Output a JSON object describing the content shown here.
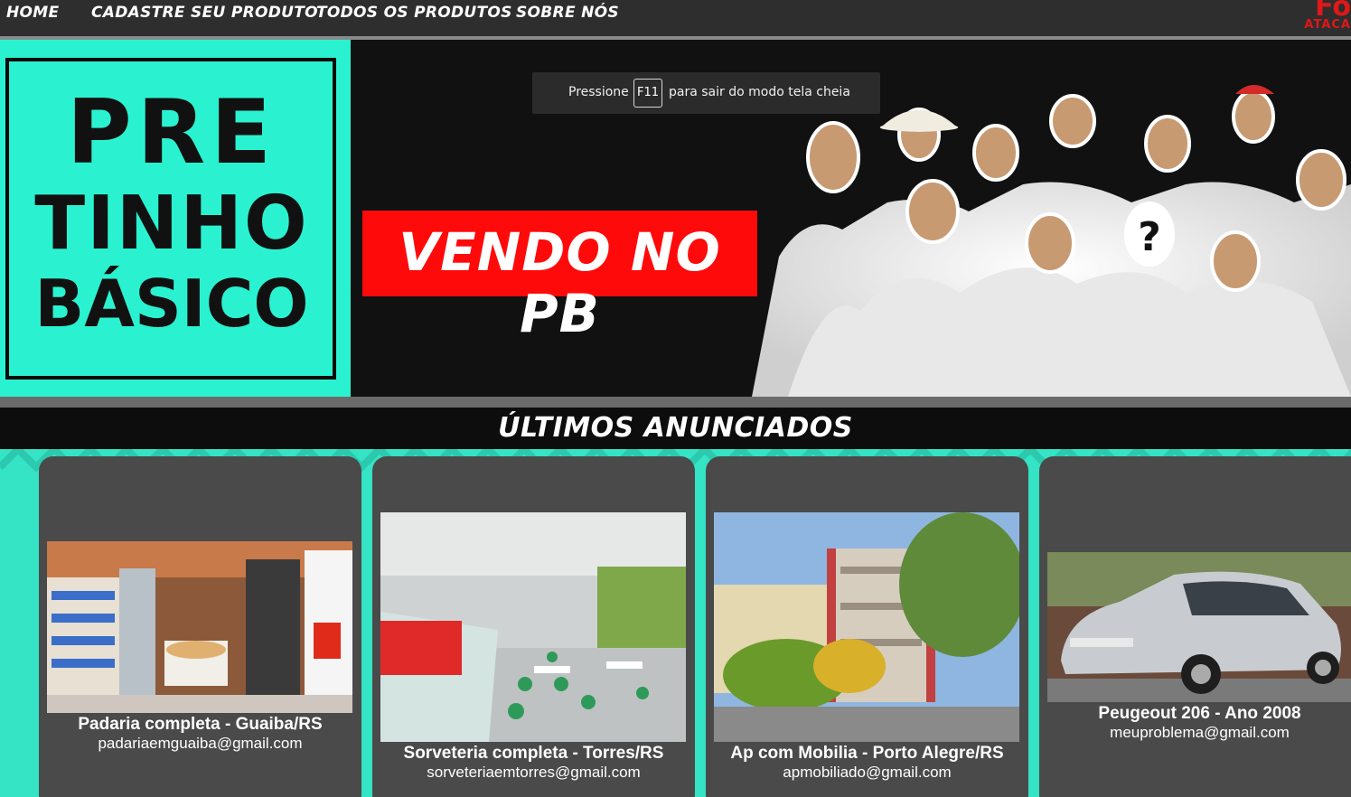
{
  "nav": {
    "items": [
      {
        "label": "HOME"
      },
      {
        "label": "CADASTRE SEU PRODUTO"
      },
      {
        "label": "TODOS OS PRODUTOS"
      },
      {
        "label": "SOBRE NÓS"
      }
    ],
    "logo_top": "Fo",
    "logo_bottom": "ATACA"
  },
  "fullscreen_toast": {
    "before": "Pressione",
    "key": "F11",
    "after": "para sair do modo tela cheia"
  },
  "hero": {
    "brand_line_1": "PRE",
    "brand_line_2": "TINHO",
    "brand_line_3": "BÁSICO",
    "badge": "VENDO NO PB"
  },
  "section": {
    "title": "ÚLTIMOS ANUNCIADOS"
  },
  "listings": [
    {
      "title": "Padaria completa - Guaiba/RS",
      "email": "padariaemguaiba@gmail.com"
    },
    {
      "title": "Sorveteria completa - Torres/RS",
      "email": "sorveteriaemtorres@gmail.com"
    },
    {
      "title": "Ap com Mobilia - Porto Alegre/RS",
      "email": "apmobiliado@gmail.com"
    },
    {
      "title": "Peugeout 206 - Ano 2008",
      "email": "meuproblema@gmail.com"
    }
  ],
  "colors": {
    "accent_teal": "#2af2d0",
    "badge_red": "#ff0a0a",
    "nav_bg": "#2e2e2e",
    "card_bg": "#4a4a4a"
  }
}
